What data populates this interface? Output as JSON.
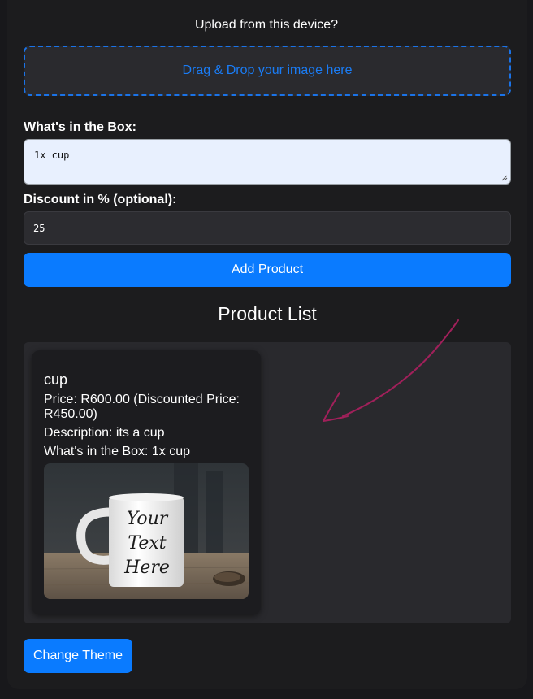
{
  "upload": {
    "label": "Upload from this device?",
    "dropzone_text": "Drag & Drop your image here"
  },
  "box_field": {
    "label": "What's in the Box:",
    "value": "1x cup"
  },
  "discount_field": {
    "label": "Discount in % (optional):",
    "value": "25"
  },
  "add_button": {
    "label": "Add Product"
  },
  "product_list": {
    "title": "Product List",
    "items": [
      {
        "name": "cup",
        "price_line": "Price: R600.00 (Discounted Price: R450.00)",
        "description_line": "Description: its a cup",
        "box_line": "What's in the Box: 1x cup",
        "image_text": [
          "Your",
          "Text",
          "Here"
        ]
      }
    ]
  },
  "theme_button": {
    "label": "Change Theme"
  },
  "colors": {
    "accent": "#0a7bff",
    "background": "#1c1c1e",
    "arrow": "#a0205a"
  }
}
